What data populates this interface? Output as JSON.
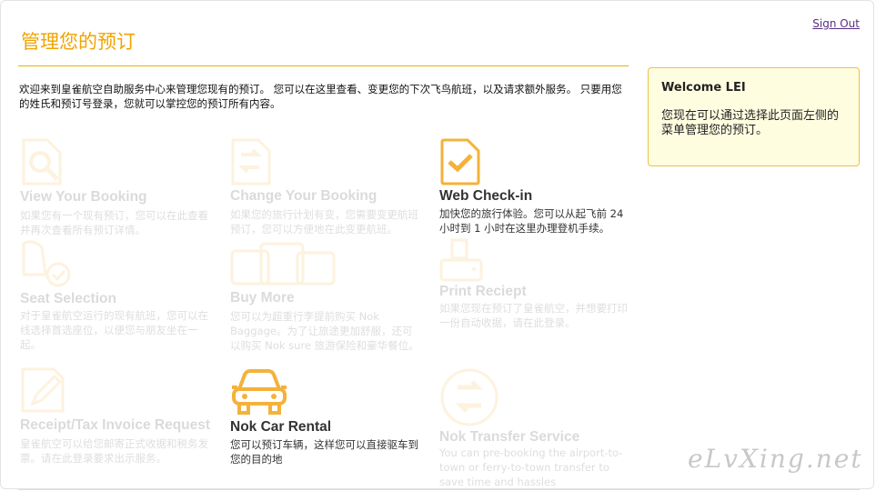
{
  "header": {
    "sign_out": "Sign Out",
    "title": "管理您的预订"
  },
  "intro": "欢迎来到皇雀航空自助服务中心来管理您现有的预订。 您可以在这里查看、变更您的下次飞鸟航班，以及请求额外服务。 只要用您的姓氏和预订号登录，您就可以掌控您的预订所有内容。",
  "welcome": {
    "title": "Welcome LEI",
    "text": "您现在可以通过选择此页面左侧的菜单管理您的预订。"
  },
  "tiles": {
    "view_booking": {
      "name": "View Your Booking",
      "desc": "如果您有一个现有预订，您可以在此查看并再次查看所有预订详情。",
      "icon": "search-document-icon"
    },
    "change_booking": {
      "name": "Change Your Booking",
      "desc": "如果您的旅行计划有变，您需要变更航班预订，您可以方便地在此变更航班。",
      "icon": "exchange-document-icon"
    },
    "web_checkin": {
      "name": "Web Check-in",
      "desc": "加快您的旅行体验。您可以从起飞前 24 小时到 1 小时在这里办理登机手续。",
      "icon": "checkmark-document-icon"
    },
    "seat_selection": {
      "name": "Seat Selection",
      "desc": "对于皇雀航空运行的现有航班，您可以在线选择首选座位，以便您与朋友坐在一起。",
      "icon": "seat-icon"
    },
    "buy_more": {
      "name": "Buy More",
      "desc": "您可以为超重行李提前购买 Nok Baggage。为了让旅途更加舒服，还可以购买 Nok sure 旅游保险和豪华餐位。",
      "icon": "luggage-icon"
    },
    "print_receipt": {
      "name": "Print Reciept",
      "desc": "如果您现在预订了皇雀航空，并想要打印一份自动收据，请在此登录。",
      "icon": "printer-icon"
    },
    "tax_invoice": {
      "name": "Receipt/Tax Invoice Request",
      "desc": "皇雀航空可以给您邮寄正式收据和税务发票。请在此登录要求出示服务。",
      "icon": "pencil-document-icon"
    },
    "car_rental": {
      "name": "Nok Car Rental",
      "desc": "您可以预订车辆，这样您可以直接驱车到您的目的地",
      "icon": "car-icon"
    },
    "transfer": {
      "name": "Nok Transfer Service",
      "desc": "You can pre-booking the airport-to-town or ferry-to-town transfer to save time and hassles",
      "icon": "transfer-arrows-icon"
    }
  },
  "watermark": "eLvXing.net",
  "colors": {
    "accent": "#f0a400",
    "icon": "#f4b23a",
    "welcome_bg": "#fffde0"
  }
}
